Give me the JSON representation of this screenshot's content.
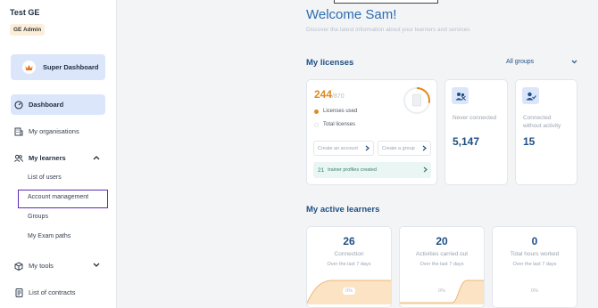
{
  "sidebar": {
    "org_name": "Test GE",
    "role_badge": "GE Admin",
    "super_dashboard": "Super Dashboard",
    "items": [
      {
        "label": "Dashboard"
      },
      {
        "label": "My organisations"
      },
      {
        "label": "My learners"
      },
      {
        "label": "My tools"
      },
      {
        "label": "List of contracts"
      }
    ],
    "learners_sub": [
      "List of users",
      "Account management",
      "Groups",
      "My Exam paths"
    ]
  },
  "main": {
    "welcome": "Welcome Sam!",
    "welcome_sub": "Discover the latest information about your learners and services",
    "licenses_title": "My licenses",
    "group_select": "All groups",
    "licenses": {
      "used": "244",
      "total": "/870",
      "used_fraction": 0.28,
      "legend_used": "Licenses used",
      "legend_total": "Total licenses",
      "create_account": "Create an account",
      "create_group": "Create a group",
      "trainer_count": "21",
      "trainer_text": "trainer profiles created"
    },
    "never_connected": {
      "label": "Never connected",
      "value": "5,147"
    },
    "connected_inactive": {
      "label_line1": "Connected",
      "label_line2": "without activity",
      "value": "15"
    },
    "active_title": "My active learners",
    "activity": [
      {
        "value": "26",
        "label": "Connection",
        "sub": "Over the last 7 days",
        "pct": "0%"
      },
      {
        "value": "20",
        "label": "Activities carried out",
        "sub": "Over the last 7 days",
        "pct": "0%"
      },
      {
        "value": "0",
        "label": "Total hours worked",
        "sub": "Over the last 7 days",
        "pct": "0%"
      }
    ]
  },
  "colors": {
    "accent": "#2b6cb0",
    "license_orange": "#e08a1e",
    "active_nav": "#dbe6fb",
    "highlight_border": "#5b2bb8",
    "chart_fill": "#fbe3c4"
  }
}
